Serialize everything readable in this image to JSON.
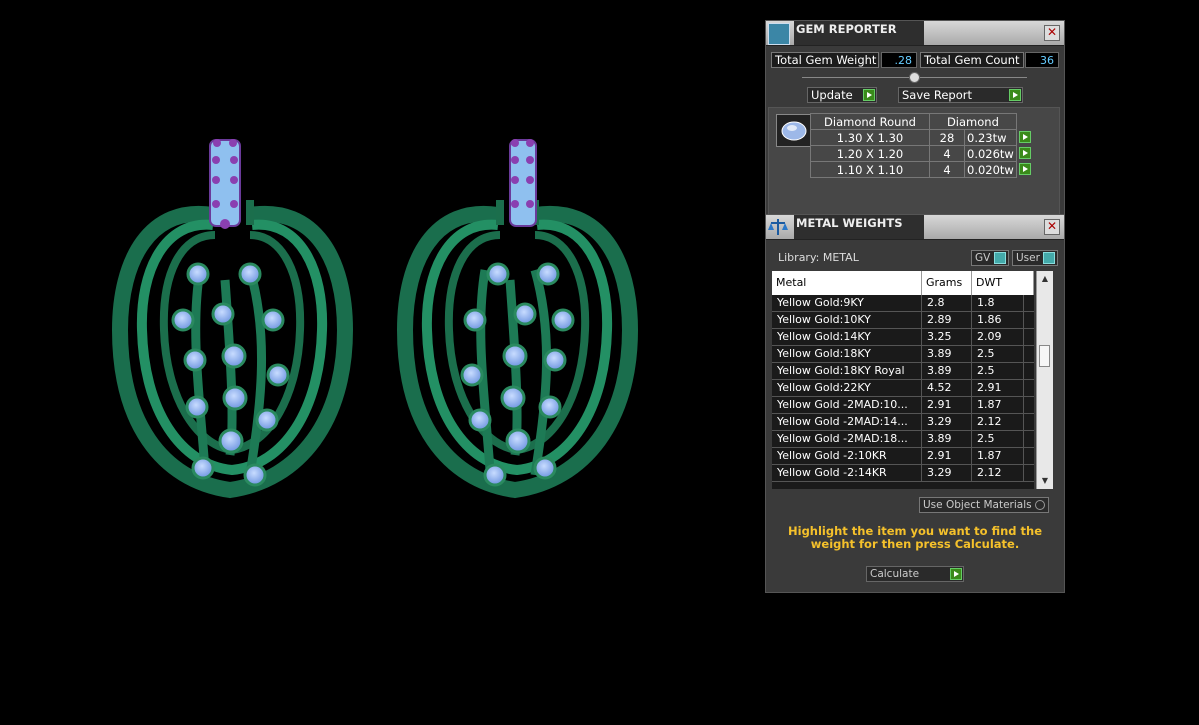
{
  "gem_reporter": {
    "title": "GEM REPORTER",
    "total_weight_label": "Total Gem Weight",
    "total_weight_value": ".28",
    "total_count_label": "Total Gem Count",
    "total_count_value": "36",
    "update_label": "Update",
    "save_label": "Save Report",
    "table": {
      "header": [
        "Diamond Round",
        "Diamond"
      ],
      "rows": [
        {
          "size": "1.30 X 1.30",
          "count": "28",
          "weight": "0.23tw"
        },
        {
          "size": "1.20 X 1.20",
          "count": "4",
          "weight": "0.026tw"
        },
        {
          "size": "1.10 X 1.10",
          "count": "4",
          "weight": "0.020tw"
        }
      ]
    }
  },
  "metal_weights": {
    "title": "METAL WEIGHTS",
    "library_label": "Library: METAL",
    "gv_label": "GV",
    "user_label": "User",
    "columns": [
      "Metal",
      "Grams",
      "DWT"
    ],
    "rows": [
      {
        "metal": "Yellow Gold:9KY",
        "grams": "2.8",
        "dwt": "1.8"
      },
      {
        "metal": "Yellow Gold:10KY",
        "grams": "2.89",
        "dwt": "1.86"
      },
      {
        "metal": "Yellow Gold:14KY",
        "grams": "3.25",
        "dwt": "2.09"
      },
      {
        "metal": "Yellow Gold:18KY",
        "grams": "3.89",
        "dwt": "2.5"
      },
      {
        "metal": "Yellow Gold:18KY Royal",
        "grams": "3.89",
        "dwt": "2.5"
      },
      {
        "metal": "Yellow Gold:22KY",
        "grams": "4.52",
        "dwt": "2.91"
      },
      {
        "metal": "Yellow Gold -2MAD:10...",
        "grams": "2.91",
        "dwt": "1.87"
      },
      {
        "metal": "Yellow Gold -2MAD:14...",
        "grams": "3.29",
        "dwt": "2.12"
      },
      {
        "metal": "Yellow Gold -2MAD:18...",
        "grams": "3.89",
        "dwt": "2.5"
      },
      {
        "metal": "Yellow Gold -2:10KR",
        "grams": "2.91",
        "dwt": "1.87"
      },
      {
        "metal": "Yellow Gold -2:14KR",
        "grams": "3.29",
        "dwt": "2.12"
      }
    ],
    "use_object_materials_label": "Use Object Materials",
    "note": "Highlight the item you want to find the weight for then press Calculate.",
    "calculate_label": "Calculate"
  },
  "colors": {
    "metal_green": "#1e7a55",
    "gem_blue": "#8fb4ee",
    "accent_purple": "#8a3fb0",
    "note_yellow": "#f5c12b"
  }
}
